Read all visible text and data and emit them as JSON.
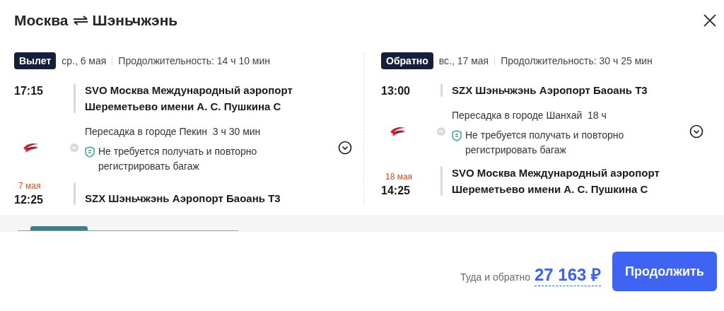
{
  "title": {
    "from": "Москва",
    "to": "Шэньчжэнь"
  },
  "legs": [
    {
      "badge": "Вылет",
      "date": "ср., 6 мая",
      "duration": "Продолжительность: 14 ч 10 мин",
      "departure": {
        "time": "17:15",
        "airport": "SVO Москва Международный аэропорт Шереметьево имени А. С. Пушкина C"
      },
      "transfer": "Пересадка в городе Пекин  3 ч 30 мин",
      "baggage_note": "Не требуется получать и повторно регистрировать багаж",
      "arrival": {
        "date": "7 мая",
        "time": "12:25",
        "airport": "SZX Шэньчжэнь Аэропорт Баоань T3"
      }
    },
    {
      "badge": "Обратно",
      "date": "вс., 17 мая",
      "duration": "Продолжительность: 30 ч 25 мин",
      "departure": {
        "time": "13:00",
        "airport": "SZX Шэньчжэнь Аэропорт Баоань T3"
      },
      "transfer": "Пересадка в городе Шанхай  18 ч",
      "baggage_note": "Не требуется получать и повторно регистрировать багаж",
      "arrival": {
        "date": "18 мая",
        "time": "14:25",
        "airport": "SVO Москва Международный аэропорт Шереметьево имени А. С. Пушкина C"
      }
    }
  ],
  "footer": {
    "price_label": "Туда и обратно",
    "price": "27 163 ₽",
    "button": "Продолжить"
  }
}
